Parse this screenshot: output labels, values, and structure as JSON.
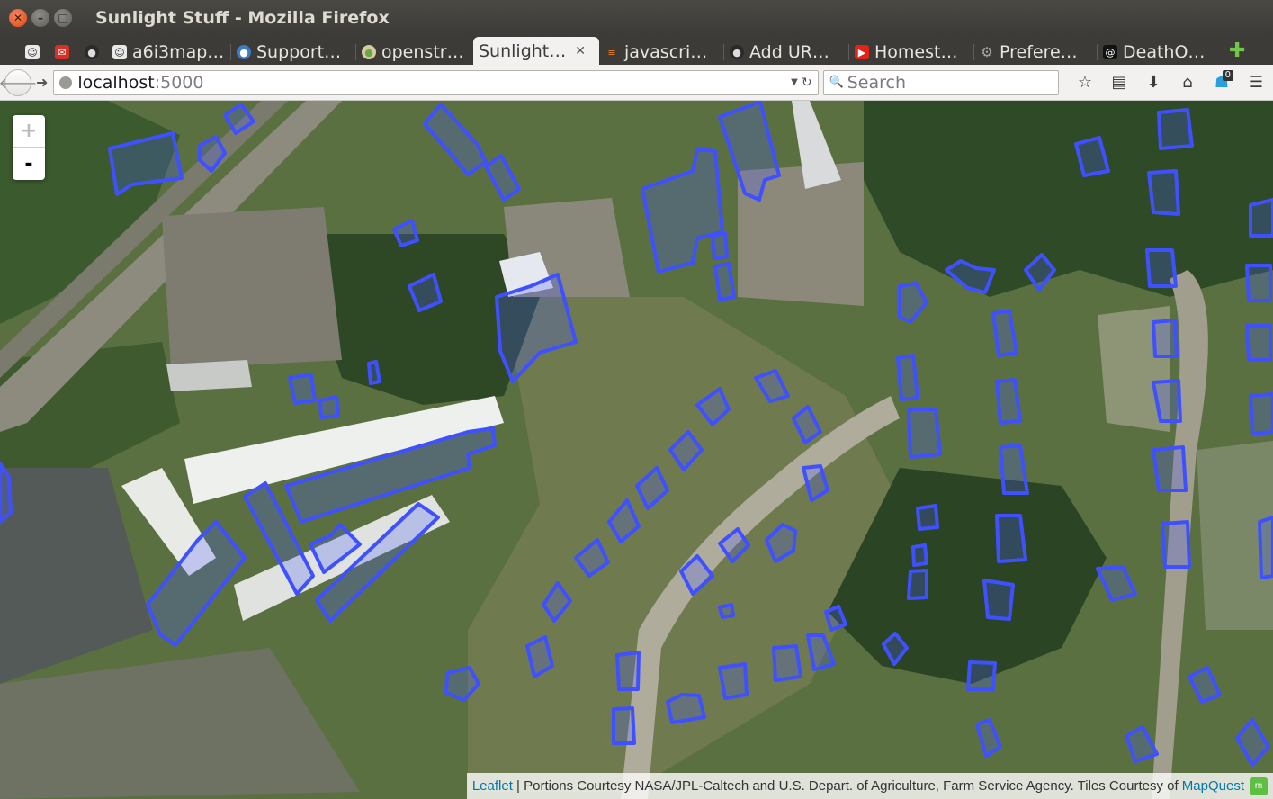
{
  "window": {
    "title": "Sunlight Stuff - Mozilla Firefox"
  },
  "tabs": [
    {
      "label": "",
      "icon": "ubuntu-icon"
    },
    {
      "label": "",
      "icon": "gmail-icon"
    },
    {
      "label": "",
      "icon": "github-icon"
    },
    {
      "label": "a6i3map…",
      "icon": "ubuntu-icon"
    },
    {
      "label": "Support…",
      "icon": "support-icon"
    },
    {
      "label": "openstr…",
      "icon": "openstreetmap-icon"
    },
    {
      "label": "Sunlight…",
      "icon": "blank-page-icon",
      "active": true
    },
    {
      "label": "javascri…",
      "icon": "stackoverflow-icon"
    },
    {
      "label": "Add UR…",
      "icon": "github-icon"
    },
    {
      "label": "Homest…",
      "icon": "youtube-icon"
    },
    {
      "label": "Prefere…",
      "icon": "gear-icon"
    },
    {
      "label": "DeathO…",
      "icon": "at-icon"
    }
  ],
  "navbar": {
    "url_host": "localhost",
    "url_port": ":5000",
    "search_placeholder": "Search",
    "notification_count": "0"
  },
  "map": {
    "zoom_in": "+",
    "zoom_out": "-",
    "attribution": {
      "leaflet_link": "Leaflet",
      "text": " | Portions Courtesy NASA/JPL-Caltech and U.S. Depart. of Agriculture, Farm Service Agency. Tiles Courtesy of ",
      "mapquest_link": "MapQuest"
    },
    "overlay_color": "#3f51ff"
  }
}
